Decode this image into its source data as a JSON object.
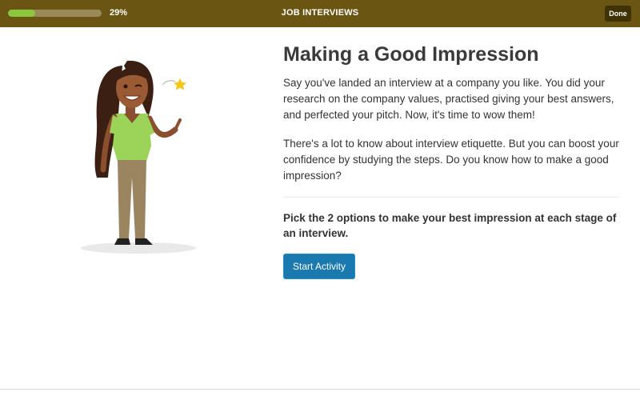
{
  "header": {
    "progress_value": 29,
    "progress_label": "29%",
    "course_title": "JOB INTERVIEWS",
    "done_label": "Done",
    "progress_fill_color": "#8cc63f",
    "bar_color": "#6b5512"
  },
  "main": {
    "title": "Making a Good Impression",
    "paragraph_1": "Say you've landed an interview at a company you like. You did your research on the company values, practised giving your best answers, and perfected your pitch. Now, it's time to wow them!",
    "paragraph_2": "There's a lot to know about interview etiquette. But you can boost your confidence by studying the steps. Do you know how to make a good impression?",
    "instruction": "Pick the 2 options to make your best impression at each stage of an interview.",
    "start_label": "Start Activity",
    "button_color": "#1a7ab0"
  },
  "illustration": {
    "subject": "woman-pointing-illustration",
    "accent_icon": "star-icon"
  }
}
